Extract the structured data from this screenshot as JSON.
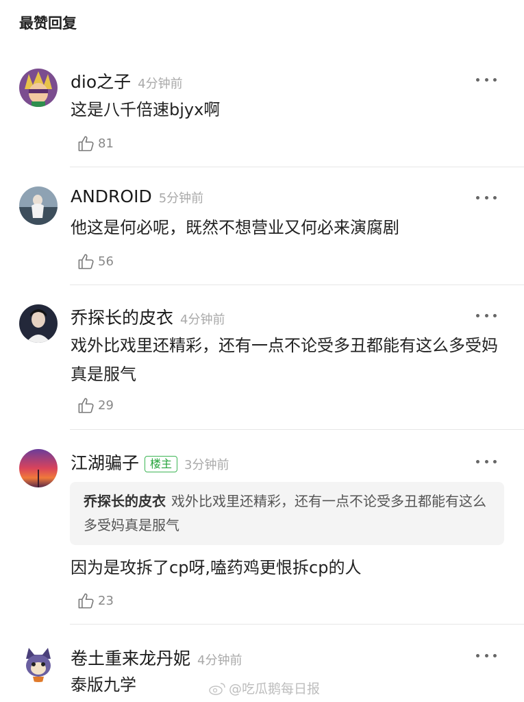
{
  "section_title": "最赞回复",
  "comments": [
    {
      "username": "dio之子",
      "time": "4分钟前",
      "text": "这是八千倍速bjyx啊",
      "likes": "81",
      "avatar": "anime-character-avatar"
    },
    {
      "username": "ANDROID",
      "time": "5分钟前",
      "text": "他这是何必呢，既然不想营业又何必来演腐剧",
      "likes": "56",
      "avatar": "figure-photo-avatar"
    },
    {
      "username": "乔探长的皮衣",
      "time": "4分钟前",
      "text": "戏外比戏里还精彩，还有一点不论受多丑都能有这么多受妈真是服气",
      "likes": "29",
      "avatar": "person-photo-avatar"
    },
    {
      "username": "江湖骗子",
      "badge": "楼主",
      "time": "3分钟前",
      "quote_user": "乔探长的皮衣",
      "quote_text": "戏外比戏里还精彩，还有一点不论受多丑都能有这么多受妈真是服气",
      "text": "因为是攻拆了cp呀,嗑药鸡更恨拆cp的人",
      "likes": "23",
      "avatar": "sunset-sky-avatar"
    },
    {
      "username": "卷土重来龙丹妮",
      "time": "4分钟前",
      "text": "泰版九学",
      "avatar": "cartoon-cat-avatar"
    }
  ],
  "watermark": "@吃瓜鹅每日报",
  "colors": {
    "badge_green": "#3cb554",
    "time_gray": "#a9a9a9",
    "quote_bg": "#f4f4f4"
  }
}
